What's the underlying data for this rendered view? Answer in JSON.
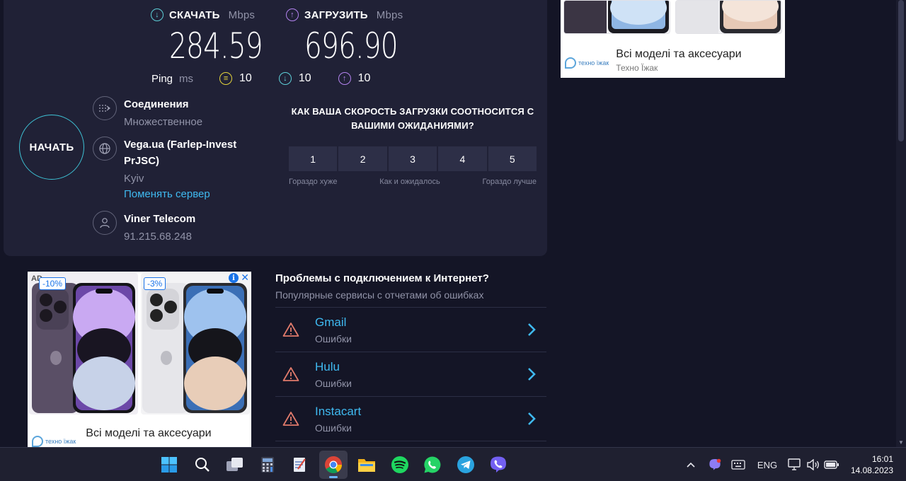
{
  "speedtest": {
    "download": {
      "label": "СКАЧАТЬ",
      "unit": "Mbps",
      "value": "284.59"
    },
    "upload": {
      "label": "ЗАГРУЗИТЬ",
      "unit": "Mbps",
      "value": "696.90"
    },
    "ping": {
      "label": "Ping",
      "unit": "ms",
      "idle": "10",
      "download": "10",
      "upload": "10"
    },
    "start_label": "НАЧАТЬ",
    "connections": {
      "title": "Соединения",
      "value": "Множественное"
    },
    "server": {
      "name": "Vega.ua (Farlep-Invest PrJSC)",
      "location": "Kyiv",
      "change_link": "Поменять сервер"
    },
    "isp": {
      "name": "Viner Telecom",
      "ip": "91.215.68.248"
    },
    "rating": {
      "question": "КАК ВАША СКОРОСТЬ ЗАГРУЗКИ СООТНОСИТСЯ С ВАШИМИ ОЖИДАНИЯМИ?",
      "options": [
        "1",
        "2",
        "3",
        "4",
        "5"
      ],
      "low_label": "Гораздо хуже",
      "mid_label": "Как и ожидалось",
      "high_label": "Гораздо лучше"
    }
  },
  "ad_top": {
    "title": "Всі моделі та аксесуари",
    "subtitle": "Техно Їжак",
    "logo_text": "техно їжак"
  },
  "ad_bottom": {
    "ad_label": "AD",
    "discount_1": "-10%",
    "discount_2": "-3%",
    "title": "Всі моделі та аксесуари",
    "logo_text": "техно їжак"
  },
  "issues": {
    "title": "Проблемы с подключением к Интернет?",
    "subtitle": "Популярные сервисы с отчетами об ошибках",
    "items": [
      {
        "name": "Gmail",
        "status": "Ошибки"
      },
      {
        "name": "Hulu",
        "status": "Ошибки"
      },
      {
        "name": "Instacart",
        "status": "Ошибки"
      }
    ]
  },
  "taskbar": {
    "language": "ENG",
    "time": "16:01",
    "date": "14.08.2023",
    "apps": [
      "windows-start",
      "search",
      "task-view",
      "calculator",
      "notepad",
      "chrome",
      "file-explorer",
      "spotify",
      "whatsapp",
      "telegram",
      "viber"
    ]
  },
  "colors": {
    "background": "#141526",
    "panel": "#202136",
    "accent_cyan": "#3ec3d6",
    "link": "#3fb9f0",
    "upload_purple": "#b483f0",
    "ping_yellow": "#e5d53c",
    "warning": "#e07a6b"
  }
}
